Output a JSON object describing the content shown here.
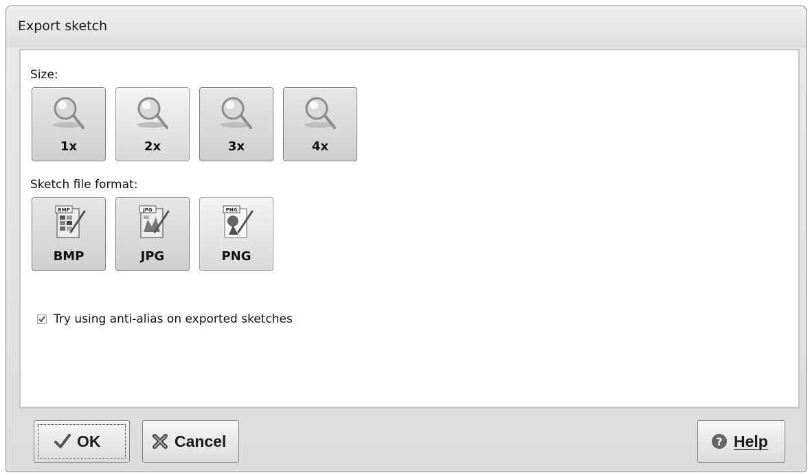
{
  "window": {
    "title": "Export sketch"
  },
  "size": {
    "label": "Size:",
    "options": [
      {
        "label": "1x",
        "icon": "zoom-icon",
        "selected": true
      },
      {
        "label": "2x",
        "icon": "zoom-icon",
        "selected": false
      },
      {
        "label": "3x",
        "icon": "zoom-icon",
        "selected": true
      },
      {
        "label": "4x",
        "icon": "zoom-icon",
        "selected": true
      }
    ]
  },
  "format": {
    "label": "Sketch file format:",
    "options": [
      {
        "label": "BMP",
        "icon": "bmp-file-icon",
        "badge": "BMP",
        "selected": true
      },
      {
        "label": "JPG",
        "icon": "jpg-file-icon",
        "badge": "JPG",
        "selected": true
      },
      {
        "label": "PNG",
        "icon": "png-file-icon",
        "badge": "PNG",
        "selected": false
      }
    ]
  },
  "antialias": {
    "label": "Try using anti-alias on exported sketches",
    "checked": true
  },
  "buttons": {
    "ok": {
      "label": "OK",
      "icon": "checkmark-icon"
    },
    "cancel": {
      "label": "Cancel",
      "icon": "cross-icon"
    },
    "help": {
      "label": "Help",
      "icon": "question-icon"
    }
  }
}
